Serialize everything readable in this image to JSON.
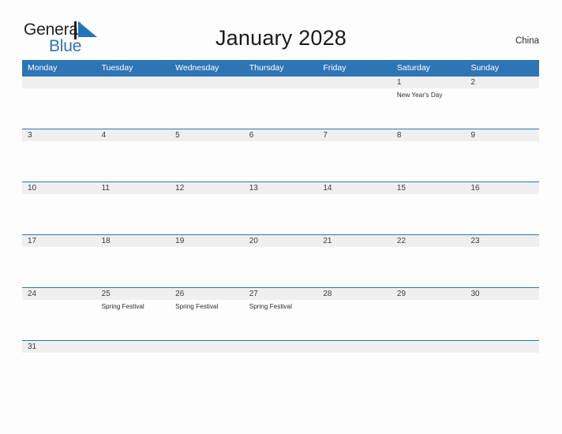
{
  "brand": {
    "name_part1": "General",
    "name_part2": "Blue",
    "triangle_icon": "triangle-logo-icon",
    "color_dark": "#231f20",
    "color_blue": "#2e75b6"
  },
  "header": {
    "title": "January 2028",
    "region": "China"
  },
  "theme": {
    "header_blue": "#2e75b6",
    "date_band_gray": "#efefef",
    "page_background": "#fdfdfd",
    "text_dark": "#3b3b3b"
  },
  "calendar": {
    "weekdays": [
      "Monday",
      "Tuesday",
      "Wednesday",
      "Thursday",
      "Friday",
      "Saturday",
      "Sunday"
    ],
    "weeks": [
      {
        "size": "tall",
        "days": [
          {
            "num": "",
            "event": ""
          },
          {
            "num": "",
            "event": ""
          },
          {
            "num": "",
            "event": ""
          },
          {
            "num": "",
            "event": ""
          },
          {
            "num": "",
            "event": ""
          },
          {
            "num": "1",
            "event": "New Year's Day"
          },
          {
            "num": "2",
            "event": ""
          }
        ]
      },
      {
        "size": "tall",
        "days": [
          {
            "num": "3",
            "event": ""
          },
          {
            "num": "4",
            "event": ""
          },
          {
            "num": "5",
            "event": ""
          },
          {
            "num": "6",
            "event": ""
          },
          {
            "num": "7",
            "event": ""
          },
          {
            "num": "8",
            "event": ""
          },
          {
            "num": "9",
            "event": ""
          }
        ]
      },
      {
        "size": "tall",
        "days": [
          {
            "num": "10",
            "event": ""
          },
          {
            "num": "11",
            "event": ""
          },
          {
            "num": "12",
            "event": ""
          },
          {
            "num": "13",
            "event": ""
          },
          {
            "num": "14",
            "event": ""
          },
          {
            "num": "15",
            "event": ""
          },
          {
            "num": "16",
            "event": ""
          }
        ]
      },
      {
        "size": "tall",
        "days": [
          {
            "num": "17",
            "event": ""
          },
          {
            "num": "18",
            "event": ""
          },
          {
            "num": "19",
            "event": ""
          },
          {
            "num": "20",
            "event": ""
          },
          {
            "num": "21",
            "event": ""
          },
          {
            "num": "22",
            "event": ""
          },
          {
            "num": "23",
            "event": ""
          }
        ]
      },
      {
        "size": "tall",
        "days": [
          {
            "num": "24",
            "event": ""
          },
          {
            "num": "25",
            "event": "Spring Festival"
          },
          {
            "num": "26",
            "event": "Spring Festival"
          },
          {
            "num": "27",
            "event": "Spring Festival"
          },
          {
            "num": "28",
            "event": ""
          },
          {
            "num": "29",
            "event": ""
          },
          {
            "num": "30",
            "event": ""
          }
        ]
      },
      {
        "size": "short",
        "days": [
          {
            "num": "31",
            "event": ""
          },
          {
            "num": "",
            "event": ""
          },
          {
            "num": "",
            "event": ""
          },
          {
            "num": "",
            "event": ""
          },
          {
            "num": "",
            "event": ""
          },
          {
            "num": "",
            "event": ""
          },
          {
            "num": "",
            "event": ""
          }
        ]
      }
    ]
  }
}
